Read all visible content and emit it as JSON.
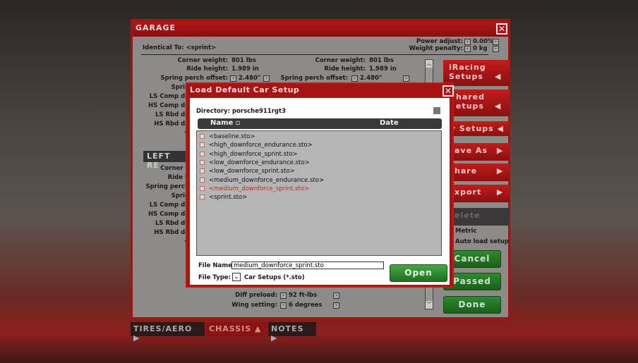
{
  "garage": {
    "title": "GARAGE",
    "identical_to": "Identical To: <sprint>",
    "power_adjust_label": "Power adjust:",
    "power_adjust": "0.00%",
    "weight_penalty_label": "Weight penalty:",
    "weight_penalty": "0 kg",
    "left_col": [
      {
        "label": "Corner weight:",
        "value": "801 lbs"
      },
      {
        "label": "Ride height:",
        "value": "1.989 in"
      },
      {
        "label": "Spring perch offset:",
        "value": "2.480\""
      }
    ],
    "right_col": [
      {
        "label": "Corner weight:",
        "value": "801 lbs"
      },
      {
        "label": "Ride height:",
        "value": "1.989 in"
      },
      {
        "label": "Spring perch offset:",
        "value": "2.480\""
      }
    ],
    "partial_labels": [
      "Sprin",
      "LS Comp da",
      "HS Comp da",
      "LS Rbd da",
      "HS Rbd da",
      "C"
    ],
    "section2_title": "LEFT RE",
    "partial_labels2": [
      "Corner v",
      "Ride h",
      "Spring perch",
      "Sprin",
      "LS Comp da",
      "HS Comp da",
      "LS Rbd da",
      "HS Rbd da",
      "C"
    ],
    "diff_preload_label": "Diff preload:",
    "diff_preload": "92 ft-lbs",
    "wing_label": "Wing setting:",
    "wing": "6 degrees"
  },
  "sidebar": {
    "items": [
      "iRacing Setups",
      "hared etups",
      "y Setups",
      "ave As",
      "hare",
      "xport",
      "elete"
    ],
    "metric": "Metric",
    "auto_load": "Auto load setup",
    "cancel": "Cancel",
    "passed": "Passed",
    "done": "Done"
  },
  "tabs": [
    "TIRES/AERO",
    "CHASSIS",
    "NOTES"
  ],
  "dialog": {
    "title": "Load Default Car Setup",
    "directory": "Directory: porsche911rgt3",
    "col_name": "Name",
    "col_date": "Date",
    "files": [
      "<baseline.sto>",
      "<high_downforce_endurance.sto>",
      "<high_downforce_sprint.sto>",
      "<low_downforce_endurance.sto>",
      "<low_downforce_sprint.sto>",
      "<medium_downforce_endurance.sto>",
      "<medium_downforce_sprint.sto>",
      "<sprint.sto>"
    ],
    "selected_index": 6,
    "selected_color": "#d42020",
    "file_name_label": "File Name:",
    "file_name": "medium_downforce_sprint.sto",
    "file_type_label": "File Type:",
    "file_type": "Car Setups (*.sto)",
    "open": "Open"
  }
}
